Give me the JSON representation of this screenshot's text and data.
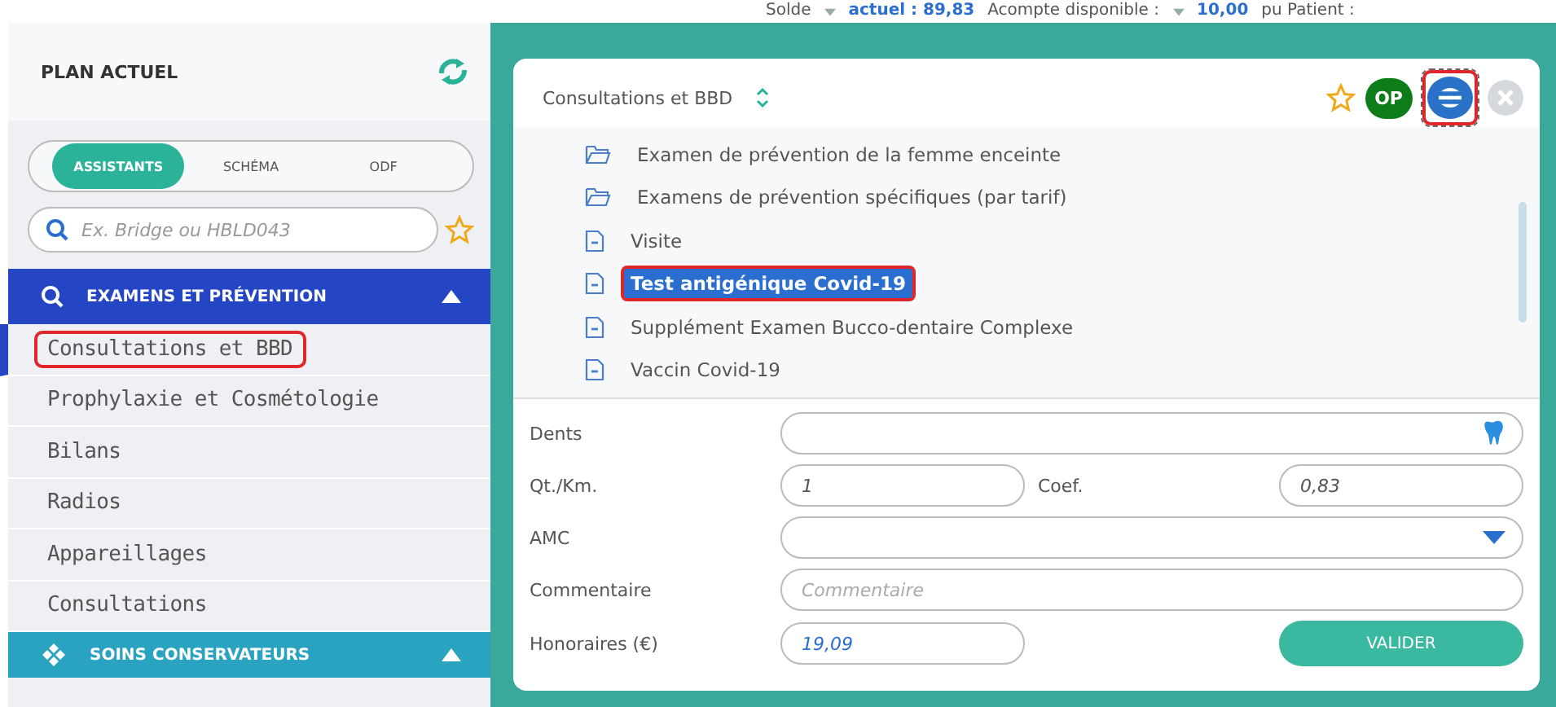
{
  "top_bar": [
    {
      "label": "Solde",
      "caret": true,
      "value": "actuel : 89,83"
    },
    {
      "label": "Acompte disponible :",
      "caret": true,
      "value": "10,00"
    },
    {
      "label": "pu Patient :",
      "caret": false
    }
  ],
  "sidebar": {
    "title": "PLAN ACTUEL",
    "tabs": [
      {
        "label": "ASSISTANTS",
        "selected": true
      },
      {
        "label": "SCHÉMA",
        "selected": false
      },
      {
        "label": "ODF",
        "selected": false
      }
    ],
    "search": {
      "placeholder": "Ex. Bridge ou HBLD043"
    },
    "sections": [
      {
        "kind": "search",
        "title": "EXAMENS ET PRÉVENTION",
        "expanded": true,
        "items": [
          {
            "label": "Consultations et BBD",
            "selected": true,
            "highlighted": true
          },
          {
            "label": "Prophylaxie et Cosmétologie",
            "selected": false,
            "highlighted": false
          },
          {
            "label": "Bilans",
            "selected": false,
            "highlighted": false
          },
          {
            "label": "Radios",
            "selected": false,
            "highlighted": false
          },
          {
            "label": "Appareillages",
            "selected": false,
            "highlighted": false
          },
          {
            "label": "Consultations",
            "selected": false,
            "highlighted": false
          }
        ]
      },
      {
        "kind": "tooth",
        "title": "SOINS CONSERVATEURS",
        "expanded": true
      }
    ]
  },
  "panel": {
    "title": "Consultations et BBD",
    "badge": "OP",
    "menu_highlighted": true,
    "tree": [
      {
        "kind": "folder",
        "label": "Examen de prévention de la femme enceinte",
        "selected": false,
        "highlighted": false
      },
      {
        "kind": "folder",
        "label": "Examens de prévention spécifiques (par tarif)",
        "selected": false,
        "highlighted": false
      },
      {
        "kind": "file",
        "label": "Visite",
        "selected": false,
        "highlighted": false
      },
      {
        "kind": "file",
        "label": "Test antigénique Covid-19",
        "selected": true,
        "highlighted": true
      },
      {
        "kind": "file",
        "label": "Supplément Examen Bucco-dentaire Complexe",
        "selected": false,
        "highlighted": false
      },
      {
        "kind": "file",
        "label": "Vaccin Covid-19",
        "selected": false,
        "highlighted": false
      }
    ],
    "form": {
      "dents": {
        "label": "Dents"
      },
      "qt": {
        "label": "Qt./Km.",
        "value": "1"
      },
      "coef": {
        "label": "Coef.",
        "value": "0,83"
      },
      "amc": {
        "label": "AMC"
      },
      "commentaire": {
        "label": "Commentaire",
        "placeholder": "Commentaire"
      },
      "honoraires": {
        "label": "Honoraires (€)",
        "value": "19,09"
      },
      "submit": "VALIDER"
    }
  }
}
